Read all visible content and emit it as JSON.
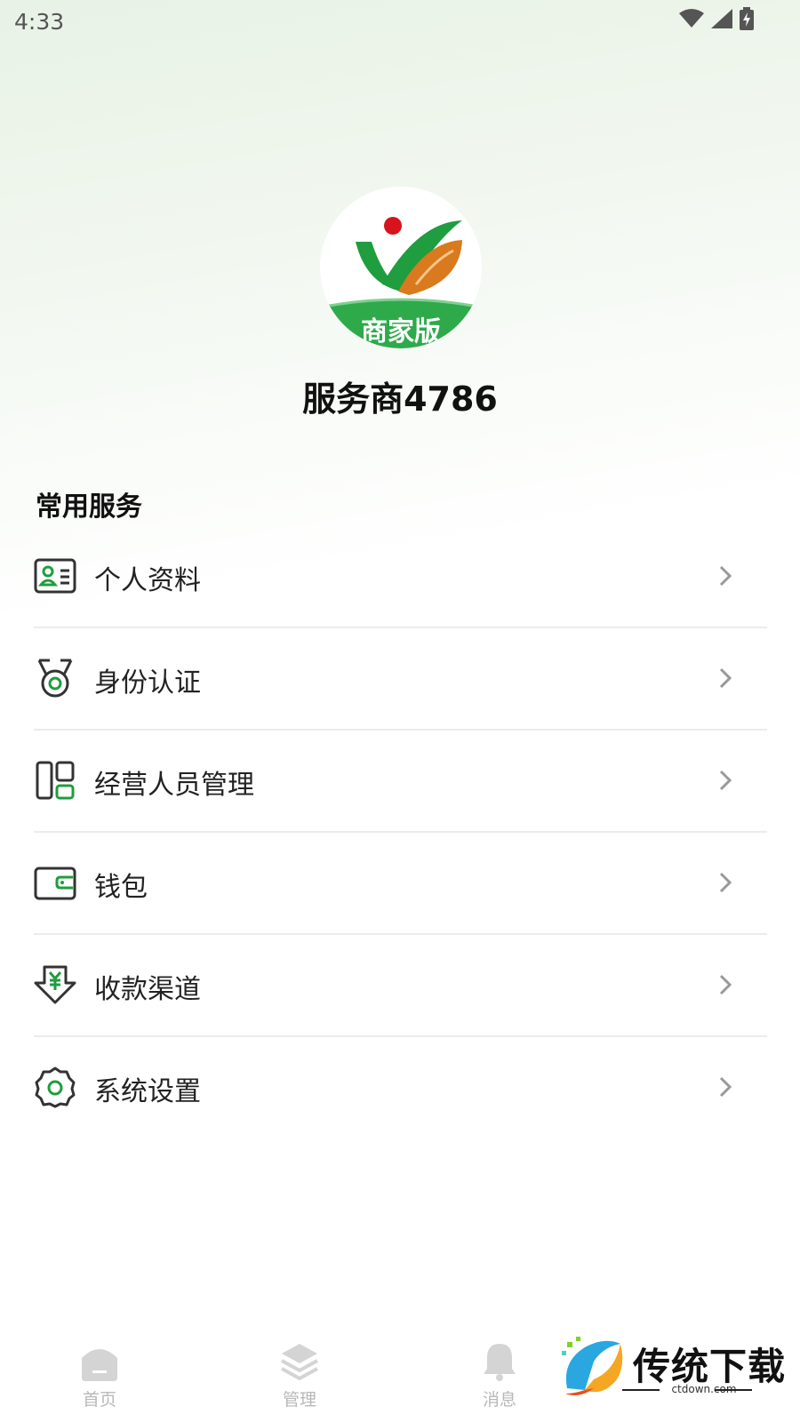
{
  "status_bar": {
    "time": "4:33"
  },
  "profile": {
    "logo_badge_text": "商家版",
    "name": "服务商4786"
  },
  "services": {
    "title": "常用服务",
    "items": [
      {
        "label": "个人资料",
        "icon": "id-card-icon"
      },
      {
        "label": "身份认证",
        "icon": "medal-icon"
      },
      {
        "label": "经营人员管理",
        "icon": "layout-grid-icon"
      },
      {
        "label": "钱包",
        "icon": "wallet-icon"
      },
      {
        "label": "收款渠道",
        "icon": "yuan-download-icon"
      },
      {
        "label": "系统设置",
        "icon": "gear-icon"
      }
    ]
  },
  "tabbar": {
    "tabs": [
      {
        "label": "首页",
        "icon": "home-icon"
      },
      {
        "label": "管理",
        "icon": "layers-icon"
      },
      {
        "label": "消息",
        "icon": "bell-icon"
      }
    ]
  },
  "watermark": {
    "title": "传统下载",
    "url": "ctdown.com"
  },
  "colors": {
    "accent": "#1f9d3f",
    "logo_orange": "#d97a1e",
    "logo_red": "#d8131b"
  }
}
